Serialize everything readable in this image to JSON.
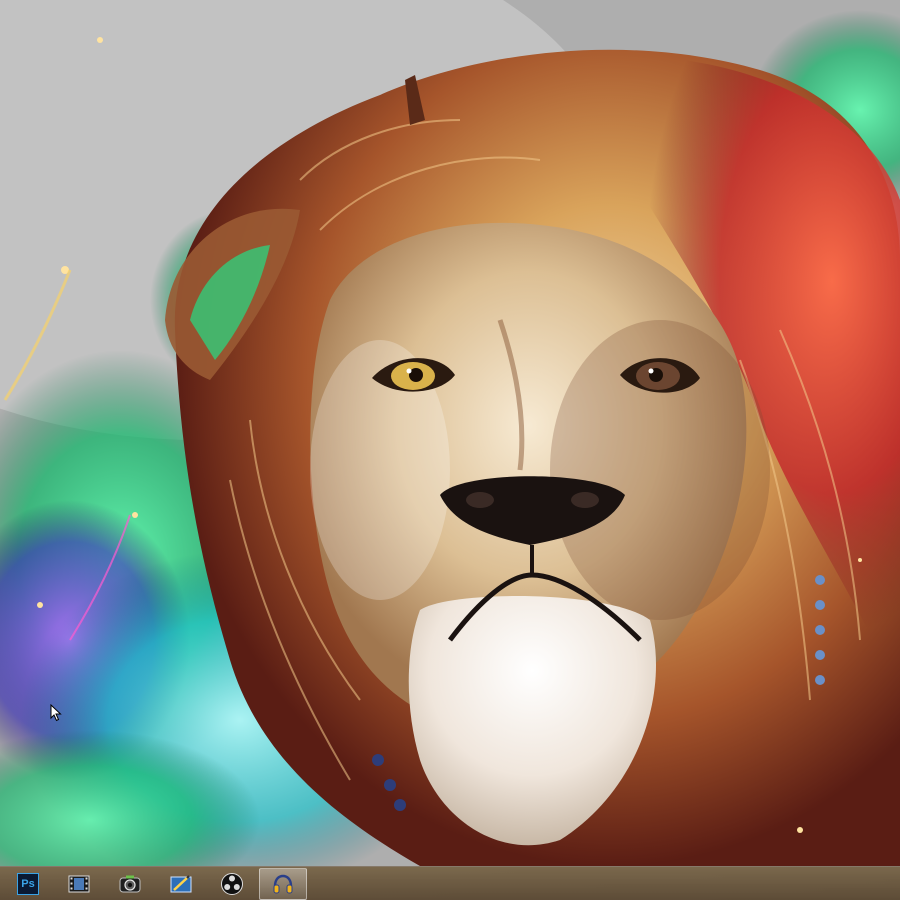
{
  "desktop": {
    "wallpaper_subject": "lion-art-wallpaper",
    "accent_colors": [
      "#1fd38a",
      "#e0463a",
      "#c8903a",
      "#7a2fd0",
      "#23c3c8"
    ]
  },
  "taskbar": {
    "apps": [
      {
        "name": "photoshop",
        "icon": "photoshop-icon",
        "label": "Ps",
        "active": false
      },
      {
        "name": "video-editor",
        "icon": "film-strip-icon",
        "active": false
      },
      {
        "name": "camera-app",
        "icon": "camera-icon",
        "active": false
      },
      {
        "name": "pen-app",
        "icon": "pen-tablet-icon",
        "active": false
      },
      {
        "name": "obs",
        "icon": "obs-icon",
        "active": false
      },
      {
        "name": "audio-app",
        "icon": "headphones-icon",
        "active": true
      }
    ]
  }
}
